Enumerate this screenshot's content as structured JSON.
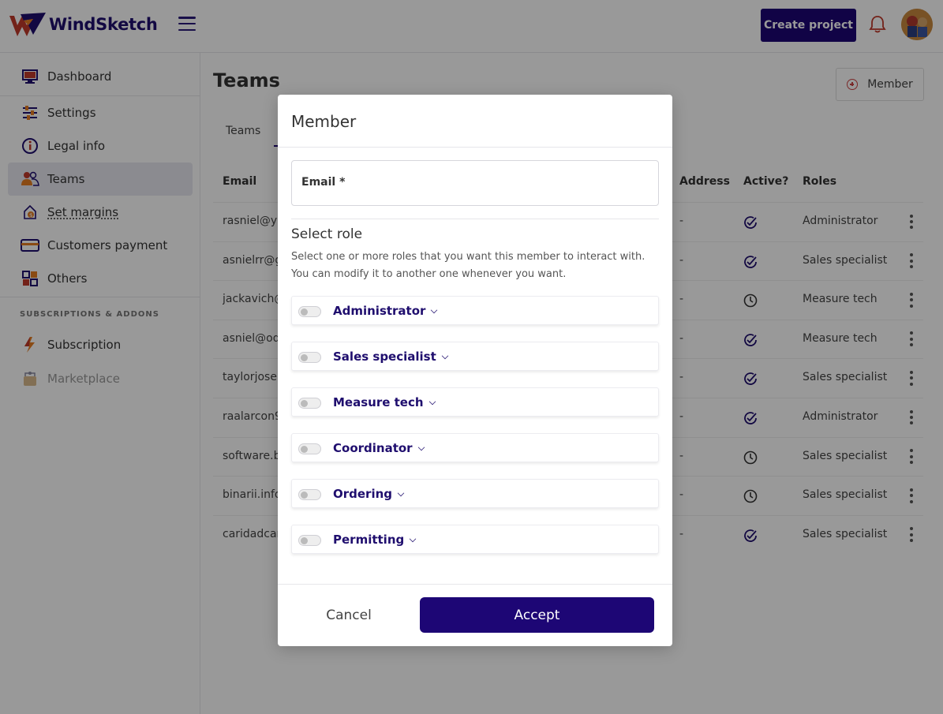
{
  "header": {
    "logo_text": "WindSketch",
    "create_project_label": "Create project",
    "bell_icon": "bell-icon",
    "avatar_icon": "avatar"
  },
  "sidebar": {
    "items": [
      {
        "label": "Dashboard",
        "icon": "monitor-icon"
      },
      {
        "label": "Settings",
        "icon": "sliders-icon"
      },
      {
        "label": "Legal info",
        "icon": "info-icon"
      },
      {
        "label": "Teams",
        "icon": "users-icon"
      },
      {
        "label": "Set margins",
        "icon": "margins-icon"
      },
      {
        "label": "Customers payment",
        "icon": "credit-card-icon"
      },
      {
        "label": "Others",
        "icon": "grid-icon"
      }
    ],
    "section_title": "SUBSCRIPTIONS & ADDONS",
    "addon_items": [
      {
        "label": "Subscription",
        "icon": "lightning-icon"
      },
      {
        "label": "Marketplace",
        "icon": "store-icon"
      }
    ]
  },
  "main": {
    "title": "Teams",
    "member_button_label": "Member",
    "tab_label": "Teams",
    "columns": {
      "email": "Email",
      "address": "Address",
      "active": "Active?",
      "roles": "Roles"
    },
    "rows": [
      {
        "email": "rasniel@ya",
        "address": "-",
        "status": "check",
        "role": "Administrator"
      },
      {
        "email": "asnielrr@g",
        "address": "-",
        "status": "check",
        "role": "Sales specialist"
      },
      {
        "email": "jackavich@",
        "address": "-",
        "status": "clock",
        "role": "Measure tech"
      },
      {
        "email": "asniel@od",
        "address": "-",
        "status": "check",
        "role": "Measure tech"
      },
      {
        "email": "taylorjosep",
        "address": "-",
        "status": "check",
        "role": "Sales specialist"
      },
      {
        "email": "raalarcon9",
        "address": "-",
        "status": "check",
        "role": "Administrator"
      },
      {
        "email": "software.b",
        "address": "-",
        "status": "clock",
        "role": "Sales specialist"
      },
      {
        "email": "binarii.info",
        "address": "-",
        "status": "clock",
        "role": "Sales specialist"
      },
      {
        "email": "caridadcar",
        "address": "-",
        "status": "check",
        "role": "Sales specialist"
      }
    ]
  },
  "modal": {
    "title": "Member",
    "email_label": "Email *",
    "email_value": "",
    "select_role_title": "Select role",
    "select_role_desc": "Select one or more roles that you want this member to interact with. You can modify it to another one whenever you want.",
    "roles": [
      {
        "label": "Administrator",
        "enabled": false
      },
      {
        "label": "Sales specialist",
        "enabled": false
      },
      {
        "label": "Measure tech",
        "enabled": false
      },
      {
        "label": "Coordinator",
        "enabled": false
      },
      {
        "label": "Ordering",
        "enabled": false
      },
      {
        "label": "Permitting",
        "enabled": false
      }
    ],
    "cancel_label": "Cancel",
    "accept_label": "Accept"
  },
  "colors": {
    "brand": "#1d0675",
    "overlay": "rgba(0,0,0,0.40)"
  }
}
